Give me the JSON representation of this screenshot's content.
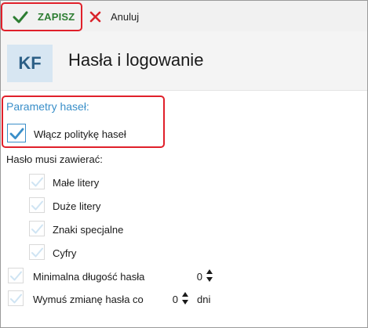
{
  "toolbar": {
    "save_label": "ZAPISZ",
    "cancel_label": "Anuluj"
  },
  "header": {
    "avatar_text": "KF",
    "title": "Hasła i logowanie"
  },
  "password_params": {
    "section_title": "Parametry haseł:",
    "enable_policy": {
      "label": "Włącz politykę haseł",
      "checked": true
    },
    "must_contain_label": "Hasło musi zawierać:",
    "requirements": [
      {
        "label": "Małe litery",
        "checked": false
      },
      {
        "label": "Duże litery",
        "checked": false
      },
      {
        "label": "Znaki specjalne",
        "checked": false
      },
      {
        "label": "Cyfry",
        "checked": false
      }
    ],
    "min_length": {
      "label": "Minimalna długość hasła",
      "value": "0",
      "checked": false
    },
    "force_change": {
      "label": "Wymuś zmianę hasła co",
      "value": "0",
      "unit": "dni",
      "checked": false
    }
  },
  "colors": {
    "accent": "#3a8fc9",
    "save_green": "#2d7d32",
    "cancel_red": "#d9242b",
    "highlight_red": "#e0202a",
    "toolbar_bg": "#f1f1f1"
  },
  "icons": {
    "save": "checkmark-icon",
    "cancel": "x-icon",
    "checkbox": "checkmark-icon",
    "spinner": "up-down-arrows-icon"
  }
}
